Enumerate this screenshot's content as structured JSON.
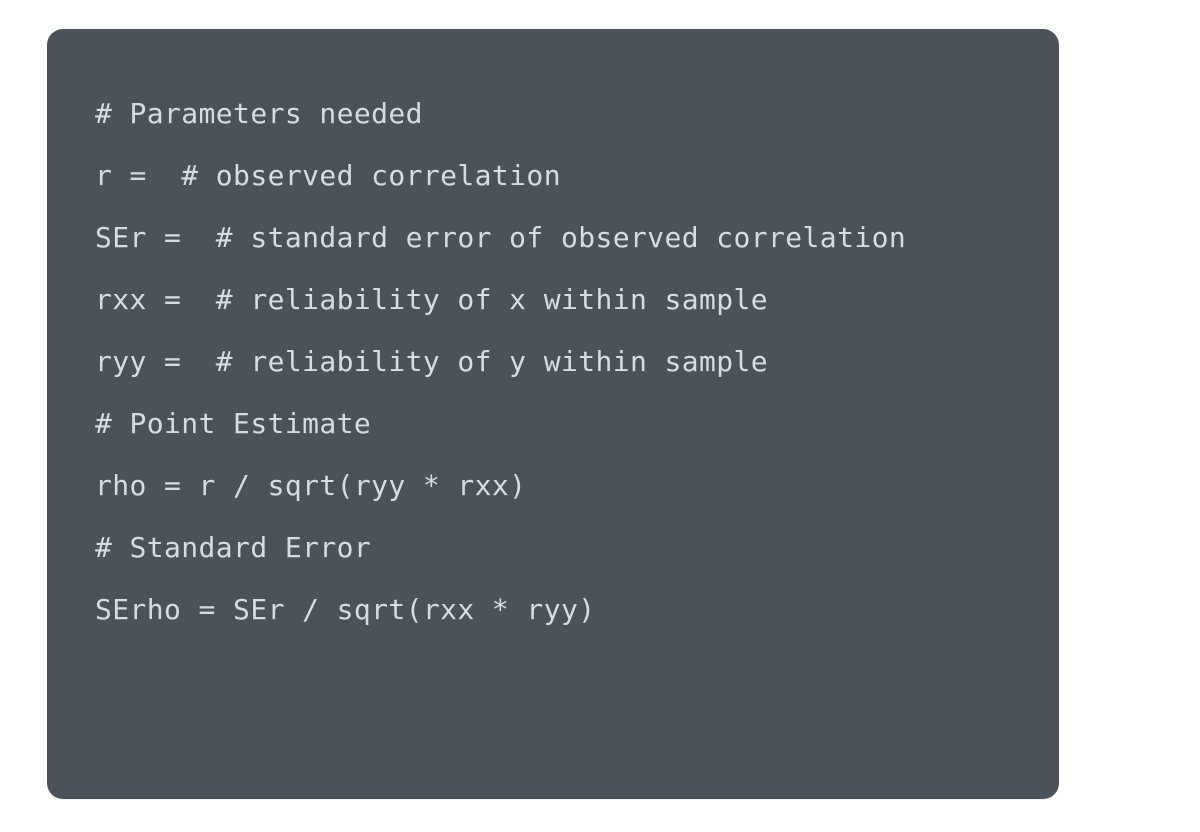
{
  "code": {
    "lines": [
      "# Parameters needed",
      "r =  # observed correlation",
      "SEr =  # standard error of observed correlation",
      "rxx =  # reliability of x within sample",
      "ryy =  # reliability of y within sample",
      "",
      "# Point Estimate",
      "rho = r / sqrt(ryy * rxx)",
      "",
      "# Standard Error",
      "SErho = SEr / sqrt(rxx * ryy)"
    ]
  }
}
